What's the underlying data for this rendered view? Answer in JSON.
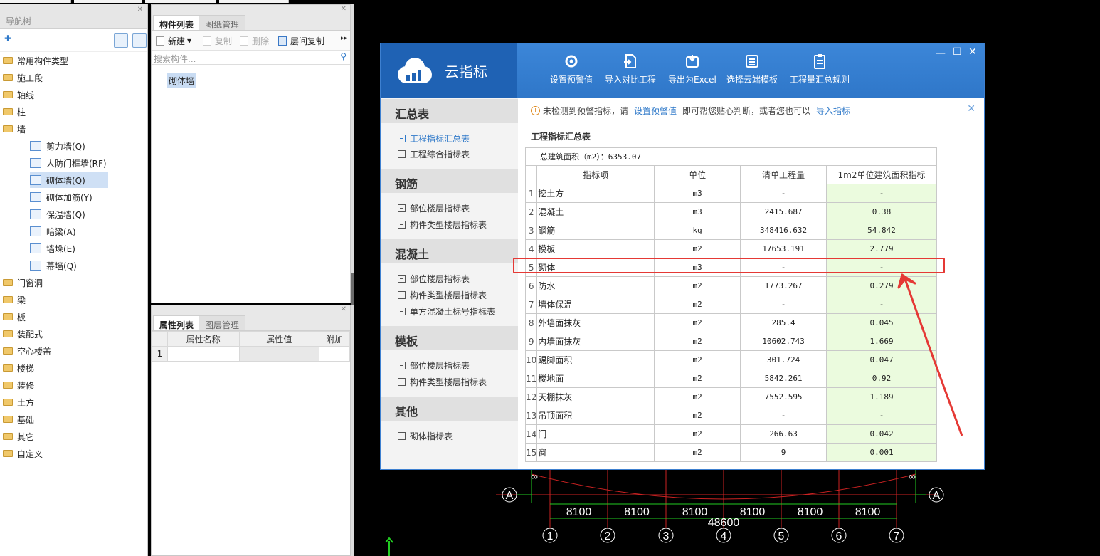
{
  "nav": {
    "title": "导航树",
    "items": [
      {
        "label": "常用构件类型"
      },
      {
        "label": "施工段"
      },
      {
        "label": "轴线"
      },
      {
        "label": "柱"
      },
      {
        "label": "墙"
      }
    ],
    "wall_children": [
      {
        "label": "剪力墙(Q)"
      },
      {
        "label": "人防门框墙(RF)"
      },
      {
        "label": "砌体墙(Q)"
      },
      {
        "label": "砌体加筋(Y)"
      },
      {
        "label": "保温墙(Q)"
      },
      {
        "label": "暗梁(A)"
      },
      {
        "label": "墙垛(E)"
      },
      {
        "label": "幕墙(Q)"
      }
    ],
    "items_after": [
      {
        "label": "门窗洞"
      },
      {
        "label": "梁"
      },
      {
        "label": "板"
      },
      {
        "label": "装配式"
      },
      {
        "label": "空心楼盖"
      },
      {
        "label": "楼梯"
      },
      {
        "label": "装修"
      },
      {
        "label": "土方"
      },
      {
        "label": "基础"
      },
      {
        "label": "其它"
      },
      {
        "label": "自定义"
      }
    ]
  },
  "complist": {
    "tab1": "构件列表",
    "tab2": "图纸管理",
    "btn_new": "新建",
    "btn_copy": "复制",
    "btn_delete": "删除",
    "btn_floorcopy": "层间复制",
    "search_placeholder": "搜索构件...",
    "item": "砌体墙"
  },
  "proplist": {
    "tab1": "属性列表",
    "tab2": "图层管理",
    "col_name": "属性名称",
    "col_value": "属性值",
    "col_extra": "附加",
    "row1": "1"
  },
  "cad": {
    "dims": [
      "8100",
      "8100",
      "8100",
      "8100",
      "8100",
      "8100"
    ],
    "total": "48600",
    "axes": [
      "1",
      "2",
      "3",
      "4",
      "5",
      "6",
      "7"
    ],
    "axis_a": "A"
  },
  "dialog": {
    "app_name": "云指标",
    "toolbar": [
      {
        "label": "设置预警值",
        "icon": "gear-icon"
      },
      {
        "label": "导入对比工程",
        "icon": "import-icon"
      },
      {
        "label": "导出为Excel",
        "icon": "export-icon"
      },
      {
        "label": "选择云端模板",
        "icon": "template-icon"
      },
      {
        "label": "工程量汇总规则",
        "icon": "clipboard-icon"
      }
    ],
    "sidebar": {
      "sec1": "汇总表",
      "sec1_items": [
        "工程指标汇总表",
        "工程综合指标表"
      ],
      "sec2": "钢筋",
      "sec2_items": [
        "部位楼层指标表",
        "构件类型楼层指标表"
      ],
      "sec3": "混凝土",
      "sec3_items": [
        "部位楼层指标表",
        "构件类型楼层指标表",
        "单方混凝土标号指标表"
      ],
      "sec4": "模板",
      "sec4_items": [
        "部位楼层指标表",
        "构件类型楼层指标表"
      ],
      "sec5": "其他",
      "sec5_items": [
        "砌体指标表"
      ]
    },
    "warning": {
      "text1": "未检测到预警指标，请",
      "link1": "设置预警值",
      "text2": "即可帮您贴心判断，或者您也可以",
      "link2": "导入指标"
    },
    "table_title": "工程指标汇总表",
    "total_area": "总建筑面积（m2）：6353.07",
    "headers": [
      "指标项",
      "单位",
      "清单工程量",
      "1m2单位建筑面积指标"
    ],
    "rows": [
      {
        "n": "1",
        "name": "挖土方",
        "unit": "m3",
        "qty": "-",
        "idx": "-"
      },
      {
        "n": "2",
        "name": "混凝土",
        "unit": "m3",
        "qty": "2415.687",
        "idx": "0.38"
      },
      {
        "n": "3",
        "name": "钢筋",
        "unit": "kg",
        "qty": "348416.632",
        "idx": "54.842"
      },
      {
        "n": "4",
        "name": "模板",
        "unit": "m2",
        "qty": "17653.191",
        "idx": "2.779"
      },
      {
        "n": "5",
        "name": "砌体",
        "unit": "m3",
        "qty": "-",
        "idx": "-"
      },
      {
        "n": "6",
        "name": "防水",
        "unit": "m2",
        "qty": "1773.267",
        "idx": "0.279"
      },
      {
        "n": "7",
        "name": "墙体保温",
        "unit": "m2",
        "qty": "-",
        "idx": "-"
      },
      {
        "n": "8",
        "name": "外墙面抹灰",
        "unit": "m2",
        "qty": "285.4",
        "idx": "0.045"
      },
      {
        "n": "9",
        "name": "内墙面抹灰",
        "unit": "m2",
        "qty": "10602.743",
        "idx": "1.669"
      },
      {
        "n": "10",
        "name": "踢脚面积",
        "unit": "m2",
        "qty": "301.724",
        "idx": "0.047"
      },
      {
        "n": "11",
        "name": "楼地面",
        "unit": "m2",
        "qty": "5842.261",
        "idx": "0.92"
      },
      {
        "n": "12",
        "name": "天棚抹灰",
        "unit": "m2",
        "qty": "7552.595",
        "idx": "1.189"
      },
      {
        "n": "13",
        "name": "吊顶面积",
        "unit": "m2",
        "qty": "-",
        "idx": "-"
      },
      {
        "n": "14",
        "name": "门",
        "unit": "m2",
        "qty": "266.63",
        "idx": "0.042"
      },
      {
        "n": "15",
        "name": "窗",
        "unit": "m2",
        "qty": "9",
        "idx": "0.001"
      }
    ]
  },
  "colors": {
    "accent": "#2f79c9",
    "header_blue": "#3c86d8",
    "highlight_red": "#e53935",
    "index_col_bg": "#ebfbde",
    "cad_red": "#cc2222",
    "cad_green": "#22cc22"
  }
}
